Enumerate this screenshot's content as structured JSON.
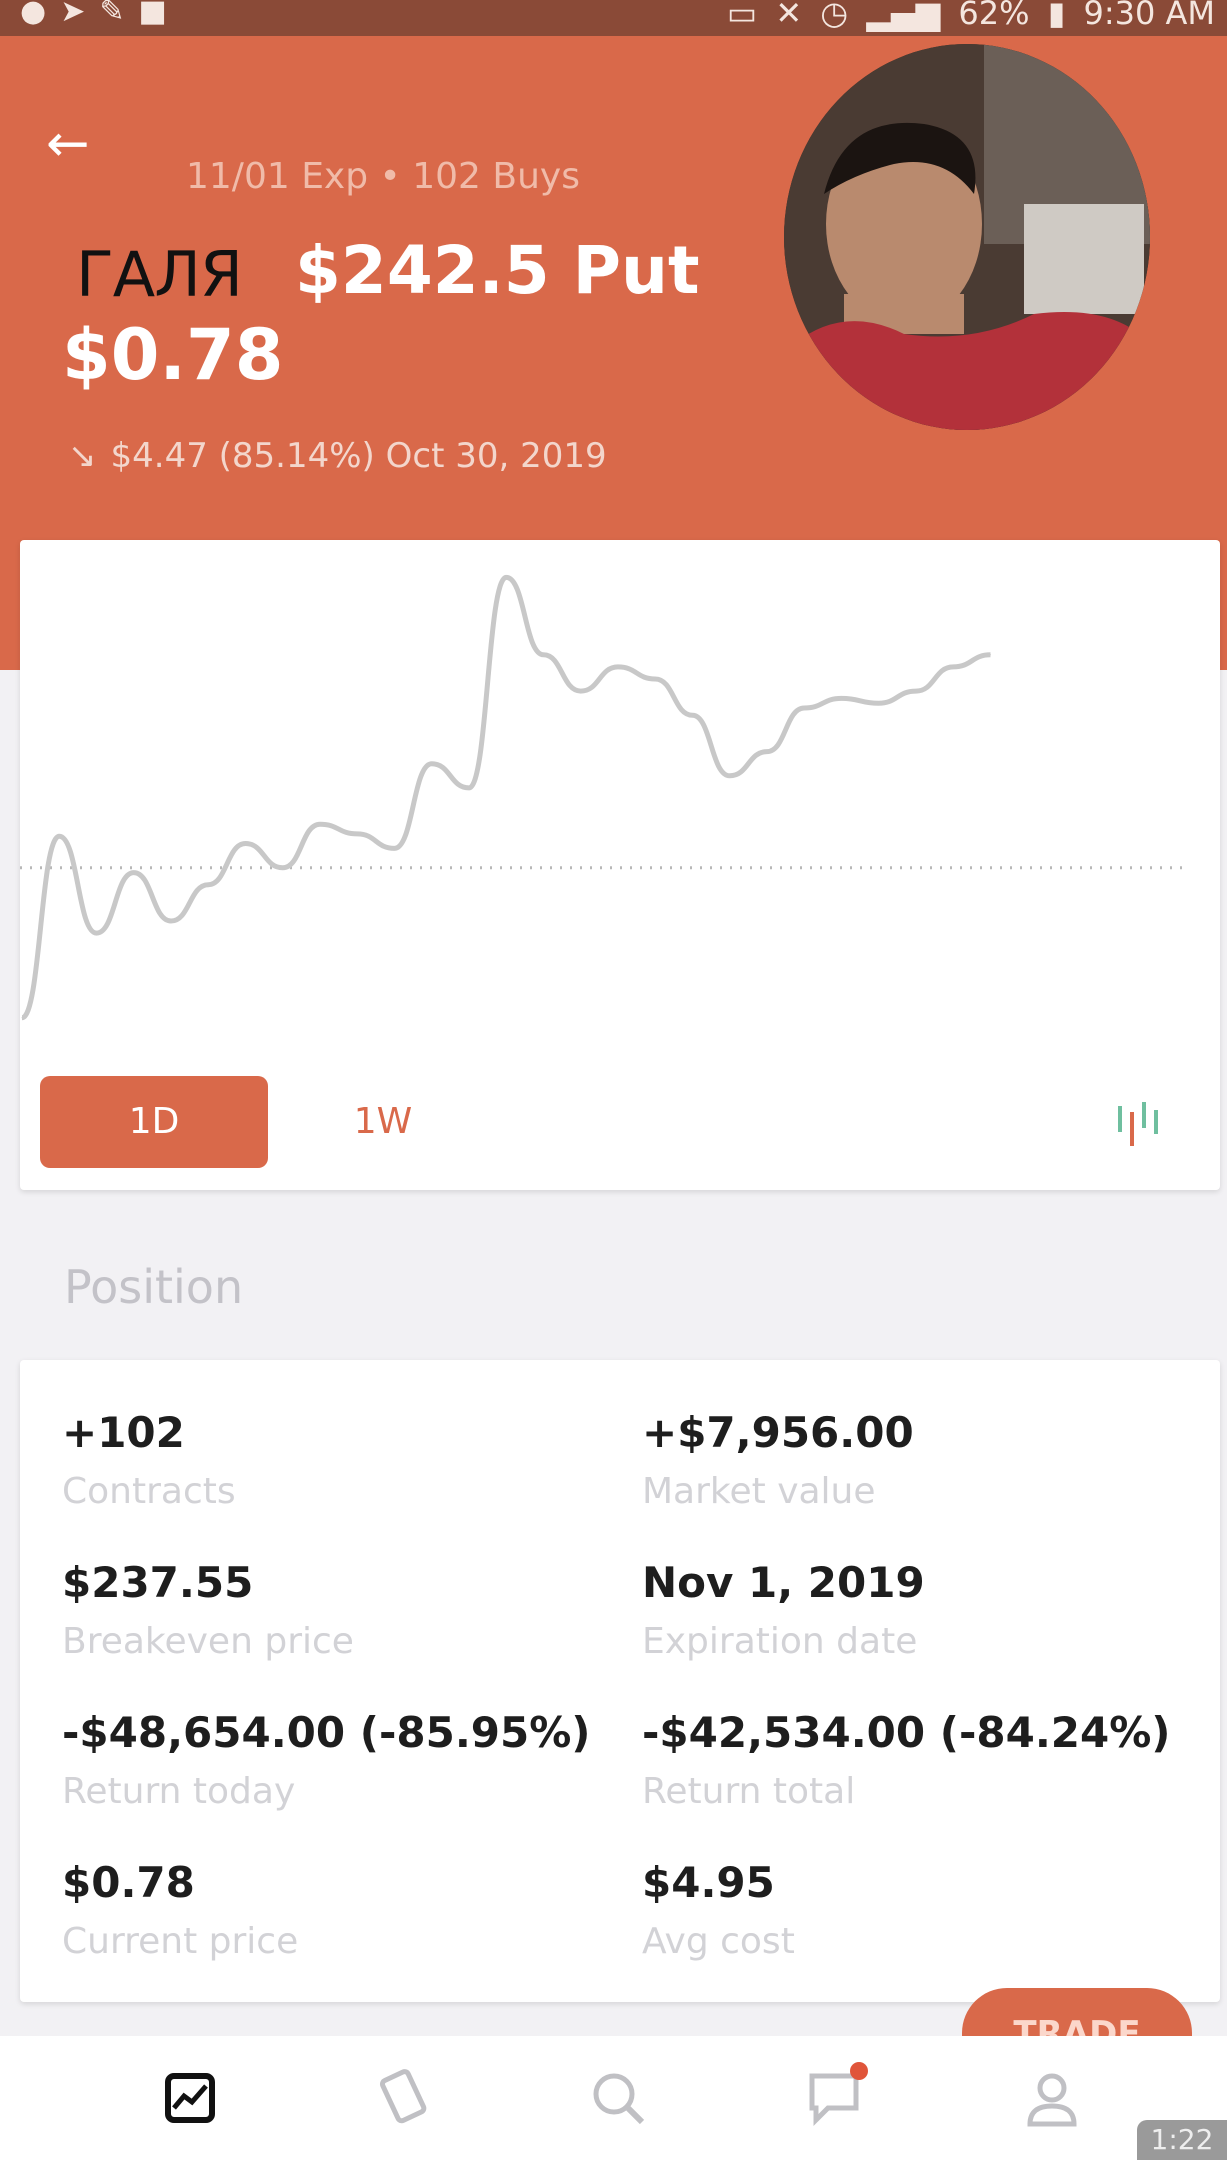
{
  "status_bar": {
    "left_icons": [
      "messenger-icon",
      "navigation-icon",
      "tools-icon",
      "camera-icon"
    ],
    "battery": "62%",
    "time": "9:30 AM"
  },
  "header": {
    "subtitle": "11/01 Exp • 102 Buys",
    "ticker_overlay": "ГАЛЯ",
    "title_rest": "$242.5 Put",
    "price": "$0.78",
    "change_arrow": "↘",
    "change_text": "$4.47 (85.14%) Oct 30, 2019",
    "accent_color": "#d9694a"
  },
  "chart": {
    "ranges": [
      "1D",
      "1W"
    ],
    "selected_range": "1D",
    "candlestick_toggle": "candlestick-icon",
    "line_color": "#c8c8c8",
    "reference_line": "dotted"
  },
  "chart_data": {
    "type": "line",
    "x": [
      0,
      1,
      2,
      3,
      4,
      5,
      6,
      7,
      8,
      9,
      10,
      11,
      12,
      13,
      14,
      15,
      16,
      17,
      18,
      19,
      20,
      21,
      22,
      23,
      24,
      25,
      26,
      27,
      28,
      29,
      30
    ],
    "y": [
      0.1,
      0.85,
      0.45,
      0.7,
      0.5,
      0.65,
      0.82,
      0.72,
      0.9,
      0.86,
      0.8,
      1.15,
      1.05,
      1.92,
      1.6,
      1.45,
      1.55,
      1.5,
      1.35,
      1.1,
      1.2,
      1.38,
      1.42,
      1.4,
      1.45,
      1.55,
      1.6,
      null,
      null,
      null,
      null
    ],
    "reference_y": 0.72,
    "ylim": [
      0,
      2
    ]
  },
  "position": {
    "section_title": "Position",
    "items": [
      {
        "value": "+102",
        "label": "Contracts"
      },
      {
        "value": "+$7,956.00",
        "label": "Market value"
      },
      {
        "value": "$237.55",
        "label": "Breakeven price"
      },
      {
        "value": "Nov 1, 2019",
        "label": "Expiration date"
      },
      {
        "value": "-$48,654.00 (-85.95%)",
        "label": "Return today"
      },
      {
        "value": "-$42,534.00 (-84.24%)",
        "label": "Return total"
      },
      {
        "value": "$0.78",
        "label": "Current price"
      },
      {
        "value": "$4.95",
        "label": "Avg cost"
      }
    ]
  },
  "trade_button": "TRADE",
  "bottom_nav": {
    "items": [
      "portfolio-icon",
      "cards-icon",
      "search-icon",
      "messages-icon",
      "account-icon"
    ]
  },
  "timer": "1:22"
}
